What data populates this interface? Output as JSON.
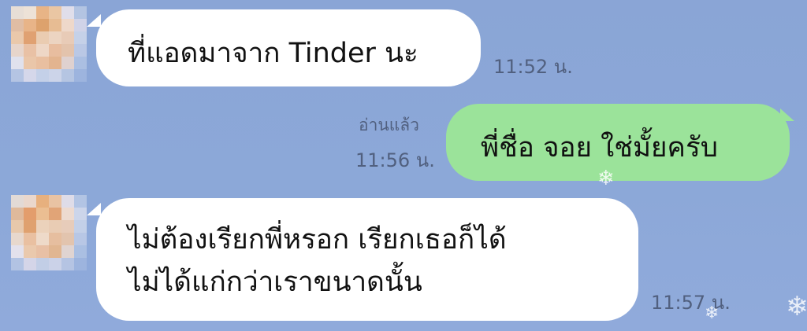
{
  "chat": {
    "messages": [
      {
        "direction": "incoming",
        "text": "ที่แอดมาจาก Tinder นะ",
        "time": "11:52 น."
      },
      {
        "direction": "outgoing",
        "status": "อ่านแล้ว",
        "text": "พี่ชื่อ จอย ใช่มั้ยครับ",
        "time": "11:56 น."
      },
      {
        "direction": "incoming",
        "line1": "ไม่ต้องเรียกพี่หรอก เรียกเธอก็ได้",
        "line2": "ไม่ได้แก่กว่าเราขนาดนั้น",
        "time": "11:57 น."
      }
    ]
  },
  "icons": {
    "avatar": "pixelated-profile-avatar",
    "decor": "snowflake-icon"
  },
  "colors": {
    "background": "#8ba6d6",
    "incoming_bubble": "#ffffff",
    "outgoing_bubble": "#9be39a",
    "meta_text": "#51607f"
  }
}
